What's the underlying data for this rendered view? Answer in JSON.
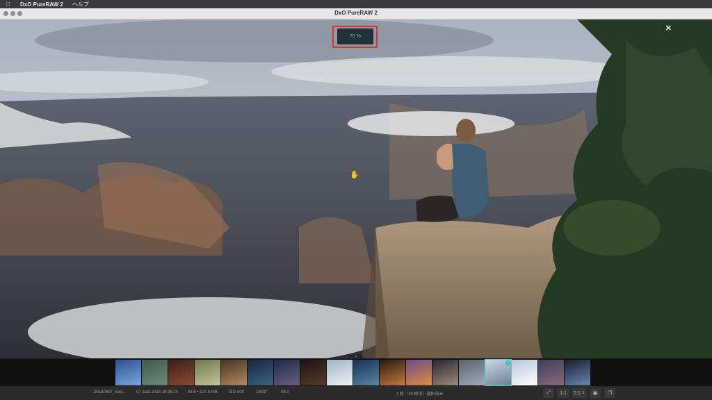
{
  "menubar": {
    "app_name": "DxO PureRAW 2",
    "help": "ヘルプ"
  },
  "window": {
    "title": "DxO PureRAW 2"
  },
  "viewer": {
    "zoom_level": "70 %",
    "close_label": "✕"
  },
  "filmstrip": {
    "thumbnails": [
      {
        "c1": "#2c4f93",
        "c2": "#7aa7dd"
      },
      {
        "c1": "#3d5a52",
        "c2": "#6f8a74"
      },
      {
        "c1": "#3a1f1a",
        "c2": "#8c4a30"
      },
      {
        "c1": "#6f7a4a",
        "c2": "#c5c29a"
      },
      {
        "c1": "#4a3424",
        "c2": "#b28a5c"
      },
      {
        "c1": "#16283e",
        "c2": "#3b6381"
      },
      {
        "c1": "#1d2a4a",
        "c2": "#6b5f7e"
      },
      {
        "c1": "#1b1410",
        "c2": "#5a3a2a"
      },
      {
        "c1": "#9fb4c8",
        "c2": "#eef2f4"
      },
      {
        "c1": "#16324f",
        "c2": "#5a86a8"
      },
      {
        "c1": "#2a1a10",
        "c2": "#c4793b"
      },
      {
        "c1": "#6a4a8a",
        "c2": "#e28c3c"
      },
      {
        "c1": "#2a2630",
        "c2": "#9a8b7a"
      },
      {
        "c1": "#586472",
        "c2": "#a2aab4"
      },
      {
        "c1": "#cbd7e2",
        "c2": "#6b8193",
        "selected": true
      },
      {
        "c1": "#b9c6d6",
        "c2": "#ffffff"
      },
      {
        "c1": "#3c3f5a",
        "c2": "#8a6a7a"
      },
      {
        "c1": "#161e32",
        "c2": "#6a86b0"
      }
    ]
  },
  "statusbar": {
    "filename": "20150807_Sed...",
    "date": "07 août 2015 18:36:24",
    "dimensions": "43.9 • 127.8 MB",
    "iso": "ISO 400",
    "shutter": "1/800\"",
    "aperture": "f/8.0",
    "selection": "1 枚（18 枚中）選択済み",
    "zoom_fit": "1:1",
    "zoom_step": "2:1"
  }
}
